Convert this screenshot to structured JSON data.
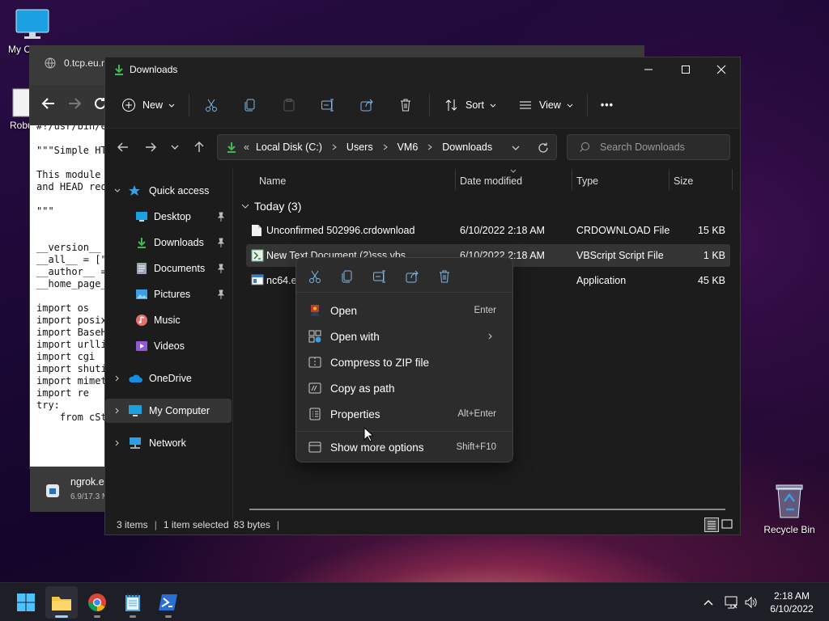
{
  "desktop": {
    "my_computer_label": "My Co",
    "robu_label": "Robu",
    "recycle_bin_label": "Recycle Bin"
  },
  "browser": {
    "tab_title": "0.tcp.eu.n",
    "code_lines": [
      "#!/usr/bin/e",
      "",
      "\"\"\"Simple HT",
      "",
      "This module",
      "and HEAD req",
      "",
      "\"\"\"",
      "",
      "",
      "__version__",
      "__all__ = [\"",
      "__author__ =",
      "__home_page_",
      "",
      "import os",
      "import posix",
      "import BaseH",
      "import urlli",
      "import cgi",
      "import shuti",
      "import mimet",
      "import re",
      "try:",
      "    from cSt"
    ],
    "download_name": "ngrok.e",
    "download_size": "6.9/17.3 M"
  },
  "explorer": {
    "window_title": "Downloads",
    "toolbar": {
      "new_label": "New",
      "sort_label": "Sort",
      "view_label": "View",
      "more_label": "•••"
    },
    "address": {
      "prefix": "«",
      "crumbs": [
        "Local Disk (C:)",
        "Users",
        "VM6",
        "Downloads"
      ]
    },
    "search_placeholder": "Search Downloads",
    "nav": {
      "quick_access": "Quick access",
      "items": [
        {
          "label": "Desktop",
          "icon": "desktop-icon"
        },
        {
          "label": "Downloads",
          "icon": "download-icon"
        },
        {
          "label": "Documents",
          "icon": "documents-icon"
        },
        {
          "label": "Pictures",
          "icon": "pictures-icon"
        },
        {
          "label": "Music",
          "icon": "music-icon"
        },
        {
          "label": "Videos",
          "icon": "videos-icon"
        }
      ],
      "onedrive": "OneDrive",
      "my_computer": "My Computer",
      "network": "Network"
    },
    "columns": {
      "name": "Name",
      "date": "Date modified",
      "type": "Type",
      "size": "Size"
    },
    "group_label": "Today (3)",
    "files": [
      {
        "name": "Unconfirmed 502996.crdownload",
        "date": "6/10/2022 2:18 AM",
        "type": "CRDOWNLOAD File",
        "size": "15 KB"
      },
      {
        "name": "New Text Document (2)sss.vbs",
        "date": "6/10/2022 2:18 AM",
        "type": "VBScript Script File",
        "size": "1 KB"
      },
      {
        "name": "nc64.ex",
        "date": "17 AM",
        "type": "Application",
        "size": "45 KB"
      }
    ],
    "status": {
      "items": "3 items",
      "selected": "1 item selected",
      "bytes": "83 bytes"
    }
  },
  "context_menu": {
    "items": [
      {
        "label": "Open",
        "shortcut": "Enter"
      },
      {
        "label": "Open with",
        "shortcut": ""
      },
      {
        "label": "Compress to ZIP file",
        "shortcut": ""
      },
      {
        "label": "Copy as path",
        "shortcut": ""
      },
      {
        "label": "Properties",
        "shortcut": "Alt+Enter"
      },
      {
        "label": "Show more options",
        "shortcut": "Shift+F10"
      }
    ]
  },
  "taskbar": {
    "time": "2:18 AM",
    "date": "6/10/2022"
  },
  "colors": {
    "accent": "#3fb950",
    "selection": "#353535",
    "folder": "#f4c542"
  }
}
